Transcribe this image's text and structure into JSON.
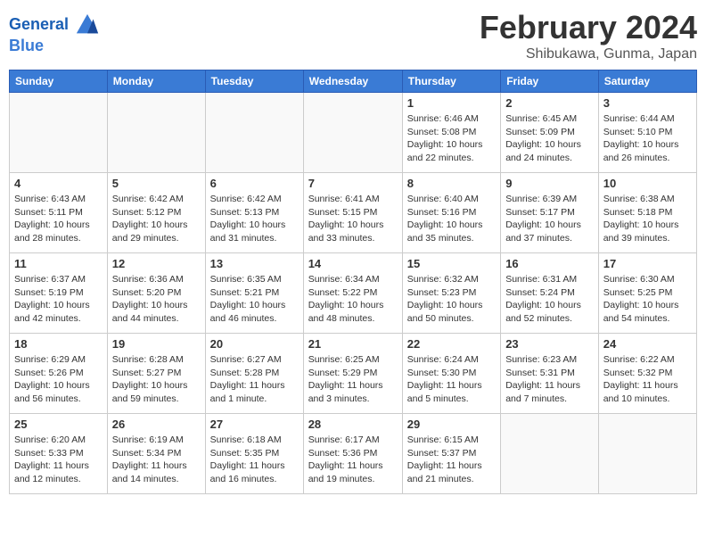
{
  "header": {
    "logo_line1": "General",
    "logo_line2": "Blue",
    "month": "February 2024",
    "location": "Shibukawa, Gunma, Japan"
  },
  "weekdays": [
    "Sunday",
    "Monday",
    "Tuesday",
    "Wednesday",
    "Thursday",
    "Friday",
    "Saturday"
  ],
  "weeks": [
    [
      {
        "day": "",
        "info": ""
      },
      {
        "day": "",
        "info": ""
      },
      {
        "day": "",
        "info": ""
      },
      {
        "day": "",
        "info": ""
      },
      {
        "day": "1",
        "info": "Sunrise: 6:46 AM\nSunset: 5:08 PM\nDaylight: 10 hours\nand 22 minutes."
      },
      {
        "day": "2",
        "info": "Sunrise: 6:45 AM\nSunset: 5:09 PM\nDaylight: 10 hours\nand 24 minutes."
      },
      {
        "day": "3",
        "info": "Sunrise: 6:44 AM\nSunset: 5:10 PM\nDaylight: 10 hours\nand 26 minutes."
      }
    ],
    [
      {
        "day": "4",
        "info": "Sunrise: 6:43 AM\nSunset: 5:11 PM\nDaylight: 10 hours\nand 28 minutes."
      },
      {
        "day": "5",
        "info": "Sunrise: 6:42 AM\nSunset: 5:12 PM\nDaylight: 10 hours\nand 29 minutes."
      },
      {
        "day": "6",
        "info": "Sunrise: 6:42 AM\nSunset: 5:13 PM\nDaylight: 10 hours\nand 31 minutes."
      },
      {
        "day": "7",
        "info": "Sunrise: 6:41 AM\nSunset: 5:15 PM\nDaylight: 10 hours\nand 33 minutes."
      },
      {
        "day": "8",
        "info": "Sunrise: 6:40 AM\nSunset: 5:16 PM\nDaylight: 10 hours\nand 35 minutes."
      },
      {
        "day": "9",
        "info": "Sunrise: 6:39 AM\nSunset: 5:17 PM\nDaylight: 10 hours\nand 37 minutes."
      },
      {
        "day": "10",
        "info": "Sunrise: 6:38 AM\nSunset: 5:18 PM\nDaylight: 10 hours\nand 39 minutes."
      }
    ],
    [
      {
        "day": "11",
        "info": "Sunrise: 6:37 AM\nSunset: 5:19 PM\nDaylight: 10 hours\nand 42 minutes."
      },
      {
        "day": "12",
        "info": "Sunrise: 6:36 AM\nSunset: 5:20 PM\nDaylight: 10 hours\nand 44 minutes."
      },
      {
        "day": "13",
        "info": "Sunrise: 6:35 AM\nSunset: 5:21 PM\nDaylight: 10 hours\nand 46 minutes."
      },
      {
        "day": "14",
        "info": "Sunrise: 6:34 AM\nSunset: 5:22 PM\nDaylight: 10 hours\nand 48 minutes."
      },
      {
        "day": "15",
        "info": "Sunrise: 6:32 AM\nSunset: 5:23 PM\nDaylight: 10 hours\nand 50 minutes."
      },
      {
        "day": "16",
        "info": "Sunrise: 6:31 AM\nSunset: 5:24 PM\nDaylight: 10 hours\nand 52 minutes."
      },
      {
        "day": "17",
        "info": "Sunrise: 6:30 AM\nSunset: 5:25 PM\nDaylight: 10 hours\nand 54 minutes."
      }
    ],
    [
      {
        "day": "18",
        "info": "Sunrise: 6:29 AM\nSunset: 5:26 PM\nDaylight: 10 hours\nand 56 minutes."
      },
      {
        "day": "19",
        "info": "Sunrise: 6:28 AM\nSunset: 5:27 PM\nDaylight: 10 hours\nand 59 minutes."
      },
      {
        "day": "20",
        "info": "Sunrise: 6:27 AM\nSunset: 5:28 PM\nDaylight: 11 hours\nand 1 minute."
      },
      {
        "day": "21",
        "info": "Sunrise: 6:25 AM\nSunset: 5:29 PM\nDaylight: 11 hours\nand 3 minutes."
      },
      {
        "day": "22",
        "info": "Sunrise: 6:24 AM\nSunset: 5:30 PM\nDaylight: 11 hours\nand 5 minutes."
      },
      {
        "day": "23",
        "info": "Sunrise: 6:23 AM\nSunset: 5:31 PM\nDaylight: 11 hours\nand 7 minutes."
      },
      {
        "day": "24",
        "info": "Sunrise: 6:22 AM\nSunset: 5:32 PM\nDaylight: 11 hours\nand 10 minutes."
      }
    ],
    [
      {
        "day": "25",
        "info": "Sunrise: 6:20 AM\nSunset: 5:33 PM\nDaylight: 11 hours\nand 12 minutes."
      },
      {
        "day": "26",
        "info": "Sunrise: 6:19 AM\nSunset: 5:34 PM\nDaylight: 11 hours\nand 14 minutes."
      },
      {
        "day": "27",
        "info": "Sunrise: 6:18 AM\nSunset: 5:35 PM\nDaylight: 11 hours\nand 16 minutes."
      },
      {
        "day": "28",
        "info": "Sunrise: 6:17 AM\nSunset: 5:36 PM\nDaylight: 11 hours\nand 19 minutes."
      },
      {
        "day": "29",
        "info": "Sunrise: 6:15 AM\nSunset: 5:37 PM\nDaylight: 11 hours\nand 21 minutes."
      },
      {
        "day": "",
        "info": ""
      },
      {
        "day": "",
        "info": ""
      }
    ]
  ]
}
